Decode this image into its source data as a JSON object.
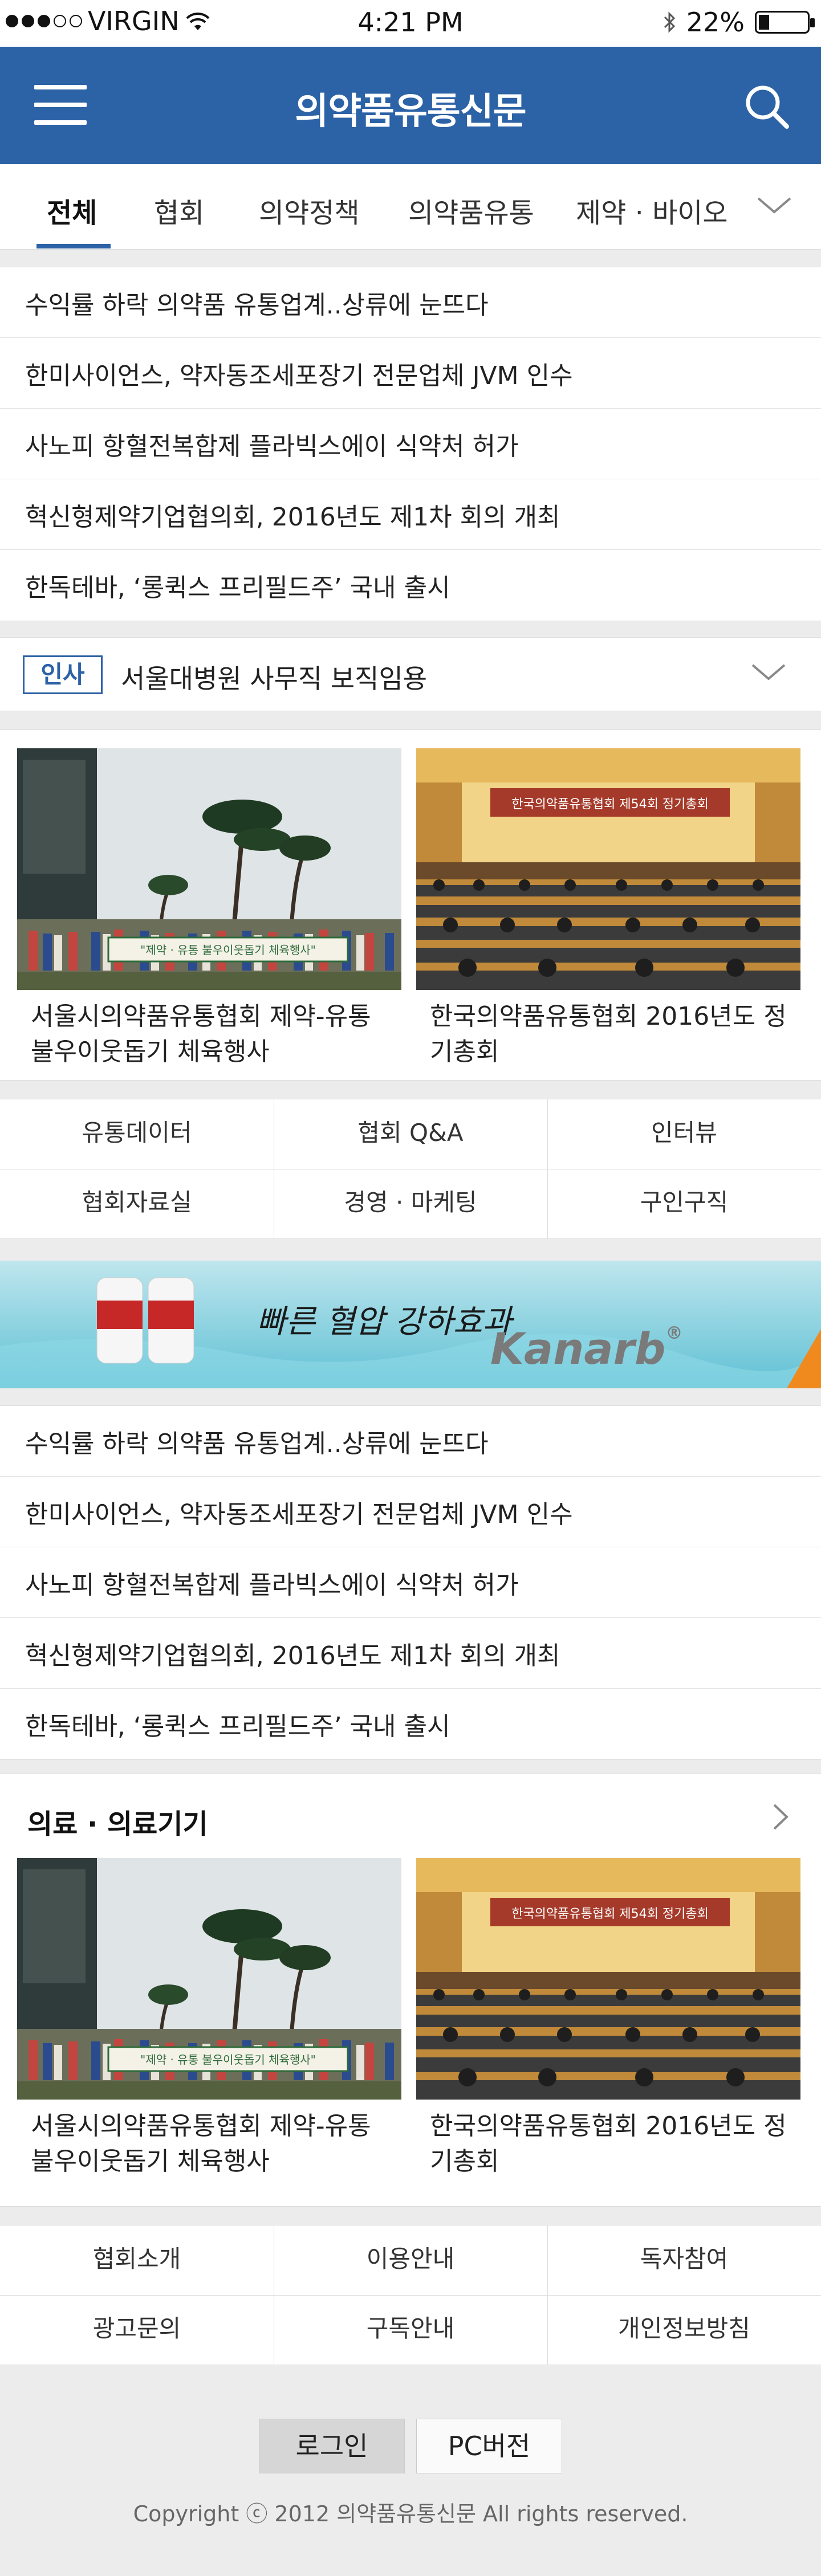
{
  "status": {
    "carrier": "VIRGIN",
    "time": "4:21 PM",
    "battery": "22%",
    "battery_level": 0.22
  },
  "header": {
    "title": "의약품유통신문",
    "menu_icon": "hamburger-icon",
    "search_icon": "search-icon"
  },
  "tabs": [
    {
      "label": "전체",
      "active": true
    },
    {
      "label": "협회"
    },
    {
      "label": "의약정책"
    },
    {
      "label": "의약품유통"
    },
    {
      "label": "제약 · 바이오"
    }
  ],
  "top_news": [
    "수익률 하락 의약품 유통업계..상류에 눈뜨다",
    "한미사이언스, 약자동조세포장기 전문업체 JVM 인수",
    "사노피 항혈전복합제 플라빅스에이 식약처 허가",
    "혁신형제약기업협의회, 2016년도 제1차 회의 개최",
    "한독테바, ‘롱퀵스 프리필드주’ 국내 출시"
  ],
  "personnel": {
    "badge": "인사",
    "text": "서울대병원 사무직 보직임용"
  },
  "photos1": [
    {
      "caption": "서울시의약품유통협회 제약-유통 불우이웃돕기 체육행사",
      "banner": "\"제약 · 유통 불우이웃돕기 체육행사\""
    },
    {
      "caption": "한국의약품유통협회 2016년도 정기총회",
      "banner": "한국의약품유통협회 제54회 정기총회"
    }
  ],
  "quick_links": [
    "유통데이터",
    "협회 Q&A",
    "인터뷰",
    "협회자료실",
    "경영 · 마케팅",
    "구인구직"
  ],
  "ad_banner": {
    "slogan": "빠른 혈압 강하효과",
    "brand": "Kanarb",
    "reg": "®"
  },
  "middle_news": [
    "수익률 하락 의약품 유통업계..상류에 눈뜨다",
    "한미사이언스, 약자동조세포장기 전문업체 JVM 인수",
    "사노피 항혈전복합제 플라빅스에이 식약처 허가",
    "혁신형제약기업협의회, 2016년도 제1차 회의 개최",
    "한독테바, ‘롱퀵스 프리필드주’ 국내 출시"
  ],
  "section_medical": {
    "title": "의료 · 의료기기"
  },
  "photos2": [
    {
      "caption": "서울시의약품유통협회 제약-유통 불우이웃돕기 체육행사",
      "banner": "\"제약 · 유통 불우이웃돕기 체육행사\""
    },
    {
      "caption": "한국의약품유통협회 2016년도 정기총회",
      "banner": "한국의약품유통협회 제54회 정기총회"
    }
  ],
  "footer_links": [
    "협회소개",
    "이용안내",
    "독자참여",
    "광고문의",
    "구독안내",
    "개인정보방침"
  ],
  "footer": {
    "login": "로그인",
    "pc_version": "PC버전",
    "copyright": "Copyright ⓒ 2012 의약품유통신문 All rights reserved."
  },
  "colors": {
    "brand": "#2c62a6"
  }
}
